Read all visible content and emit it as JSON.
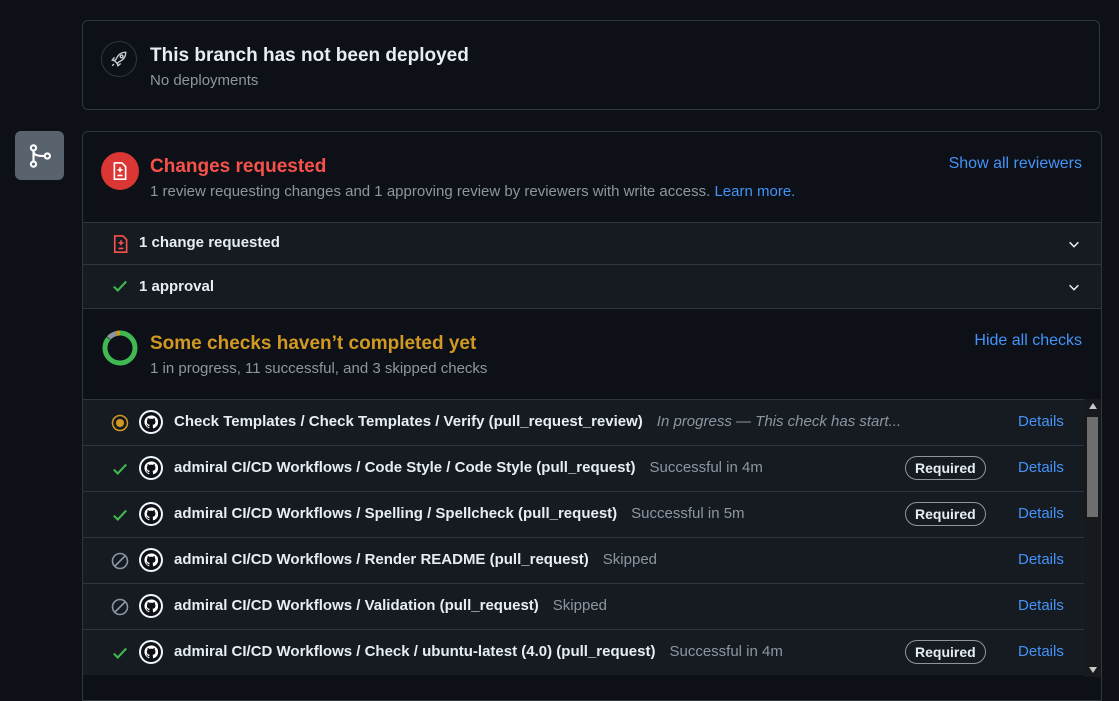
{
  "deployment": {
    "title": "This branch has not been deployed",
    "subtitle": "No deployments",
    "icon": "rocket-icon"
  },
  "review": {
    "title": "Changes requested",
    "subtitle": "1 review requesting changes and 1 approving review by reviewers with write access.",
    "learn_more": "Learn more.",
    "show_all": "Show all reviewers",
    "rows": [
      {
        "label": "1 change requested",
        "icon": "file-diff-icon"
      },
      {
        "label": "1 approval",
        "icon": "check-icon"
      }
    ]
  },
  "checks": {
    "title": "Some checks haven’t completed yet",
    "subtitle": "1 in progress, 11 successful, and 3 skipped checks",
    "hide_all": "Hide all checks",
    "details_label": "Details",
    "required_label": "Required",
    "items": [
      {
        "name": "Check Templates / Check Templates / Verify (pull_request_review)",
        "status": "In progress — This check has start...",
        "state": "in-progress",
        "required": false
      },
      {
        "name": "admiral CI/CD Workflows / Code Style / Code Style (pull_request)",
        "status": "Successful in 4m",
        "state": "success",
        "required": true
      },
      {
        "name": "admiral CI/CD Workflows / Spelling / Spellcheck (pull_request)",
        "status": "Successful in 5m",
        "state": "success",
        "required": true
      },
      {
        "name": "admiral CI/CD Workflows / Render README (pull_request)",
        "status": "Skipped",
        "state": "skipped",
        "required": false
      },
      {
        "name": "admiral CI/CD Workflows / Validation (pull_request)",
        "status": "Skipped",
        "state": "skipped",
        "required": false
      },
      {
        "name": "admiral CI/CD Workflows / Check / ubuntu-latest (4.0) (pull_request)",
        "status": "Successful in 4m",
        "state": "success",
        "required": true
      }
    ]
  },
  "colors": {
    "background": "#0d1117",
    "danger": "#f85149",
    "attention": "#d29922",
    "success": "#3fb950",
    "accent": "#4493f8"
  }
}
